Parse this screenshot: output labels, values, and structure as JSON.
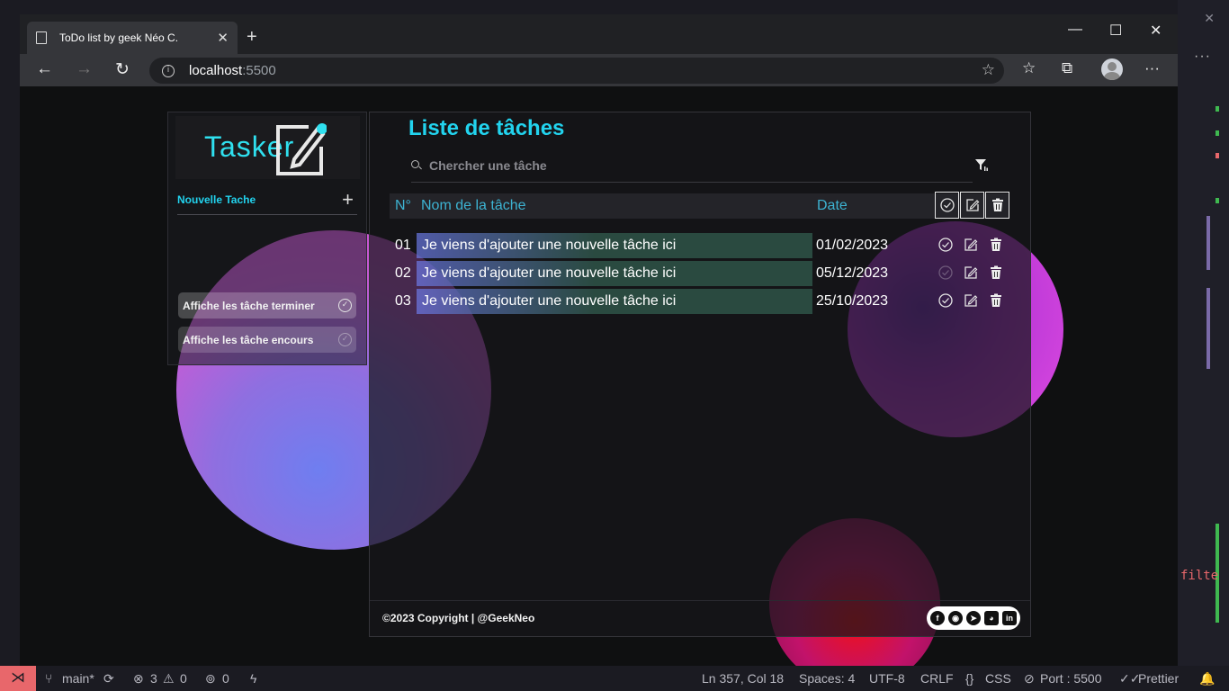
{
  "browser": {
    "tab_title": "ToDo list by geek Néo C.",
    "url_host": "localhost",
    "url_port": ":5500"
  },
  "app": {
    "logo_text": "Tasker",
    "new_task_label": "Nouvelle Tache",
    "filters": [
      {
        "label": "Affiche les tâche terminer"
      },
      {
        "label": "Affiche les tâche encours"
      }
    ],
    "title": "Liste de tâches",
    "search": {
      "placeholder": "Chercher une tâche",
      "value": ""
    },
    "table": {
      "columns": [
        "N°",
        "Nom de la tâche",
        "Date"
      ],
      "rows": [
        {
          "num": "01",
          "name": "Je viens d'ajouter une nouvelle tâche ici",
          "date": "01/02/2023"
        },
        {
          "num": "02",
          "name": "Je viens d'ajouter une nouvelle tâche ici",
          "date": "05/12/2023"
        },
        {
          "num": "03",
          "name": "Je viens d'ajouter une nouvelle tâche ici",
          "date": "25/10/2023"
        }
      ]
    },
    "footer": {
      "copyright": "©2023 Copyright | @GeekNeo"
    },
    "socials": [
      "facebook-icon",
      "github-icon",
      "telegram-icon",
      "discord-icon",
      "linkedin-icon"
    ]
  },
  "editor": {
    "code_snippet": "filte"
  },
  "statusbar": {
    "branch": "main*",
    "errors": "3",
    "warnings": "0",
    "ports": "0",
    "position": "Ln 357, Col 18",
    "spaces": "Spaces: 4",
    "encoding": "UTF-8",
    "eol": "CRLF",
    "language": "CSS",
    "port": "Port : 5500",
    "formatter": "Prettier"
  },
  "colors": {
    "accent": "#22d3ee",
    "row_name_bg_start": "#6f7ef0",
    "row_name_bg_end": "#2a4a40",
    "remote_badge": "#e8676b"
  }
}
